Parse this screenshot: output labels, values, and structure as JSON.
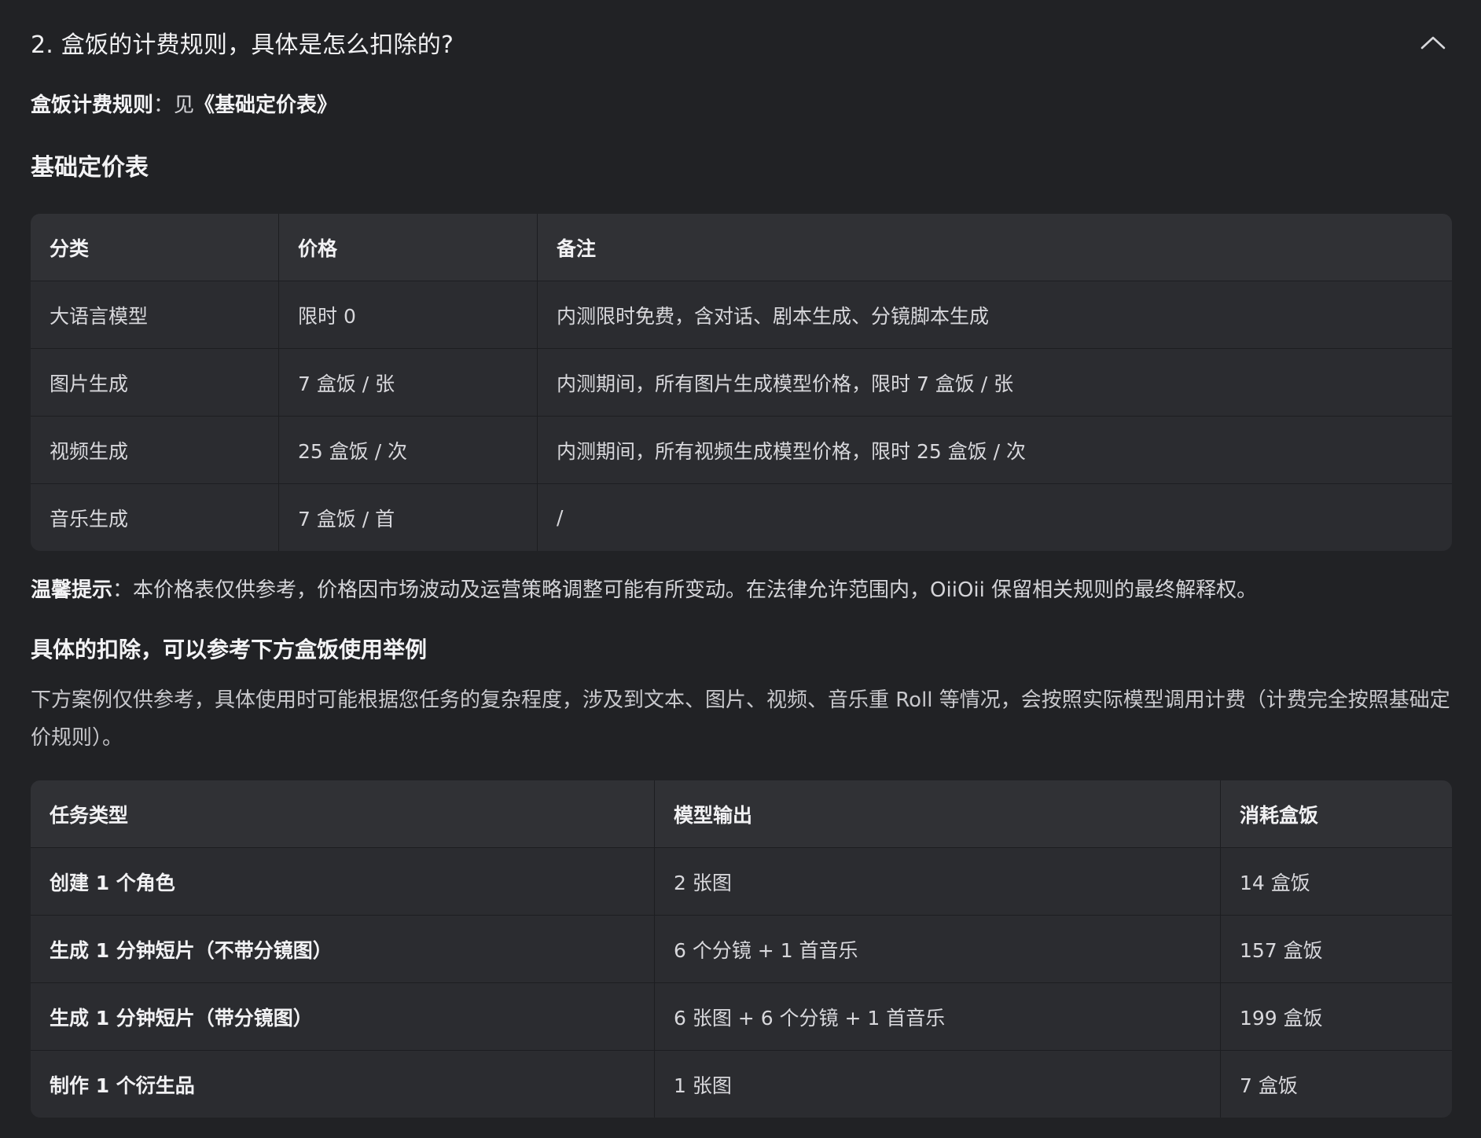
{
  "faq": {
    "question": "2. 盒饭的计费规则，具体是怎么扣除的?",
    "toggle_icon": "chevron-up-icon"
  },
  "billing_rule": {
    "label": "盒饭计费规则",
    "colon": "：",
    "prefix": "见",
    "link_text": "《基础定价表》"
  },
  "pricing": {
    "title": "基础定价表",
    "headers": [
      "分类",
      "价格",
      "备注"
    ],
    "rows": [
      {
        "category": "大语言模型",
        "price": "限时 0",
        "note": "内测限时免费，含对话、剧本生成、分镜脚本生成"
      },
      {
        "category": "图片生成",
        "price": "7 盒饭 / 张",
        "note": "内测期间，所有图片生成模型价格，限时 7 盒饭 / 张"
      },
      {
        "category": "视频生成",
        "price": "25 盒饭 / 次",
        "note": "内测期间，所有视频生成模型价格，限时 25 盒饭 / 次"
      },
      {
        "category": "音乐生成",
        "price": "7 盒饭 / 首",
        "note": "/"
      }
    ]
  },
  "tip": {
    "label": "温馨提示",
    "colon": "：",
    "text": "本价格表仅供参考，价格因市场波动及运营策略调整可能有所变动。在法律允许范围内，OiiOii 保留相关规则的最终解释权。"
  },
  "examples": {
    "title": "具体的扣除，可以参考下方盒饭使用举例",
    "description": "下方案例仅供参考，具体使用时可能根据您任务的复杂程度，涉及到文本、图片、视频、音乐重 Roll 等情况，会按照实际模型调用计费（计费完全按照基础定价规则）。",
    "headers": [
      "任务类型",
      "模型输出",
      "消耗盒饭"
    ],
    "rows": [
      {
        "task": "创建 1 个角色",
        "output": "2 张图",
        "cost": "14 盒饭"
      },
      {
        "task": "生成 1 分钟短片（不带分镜图）",
        "output": "6 个分镜 + 1 首音乐",
        "cost": "157 盒饭"
      },
      {
        "task": "生成 1 分钟短片（带分镜图）",
        "output": "6 张图 + 6 个分镜 + 1 首音乐",
        "cost": "199 盒饭"
      },
      {
        "task": "制作 1 个衍生品",
        "output": "1 张图",
        "cost": "7 盒饭"
      }
    ]
  }
}
